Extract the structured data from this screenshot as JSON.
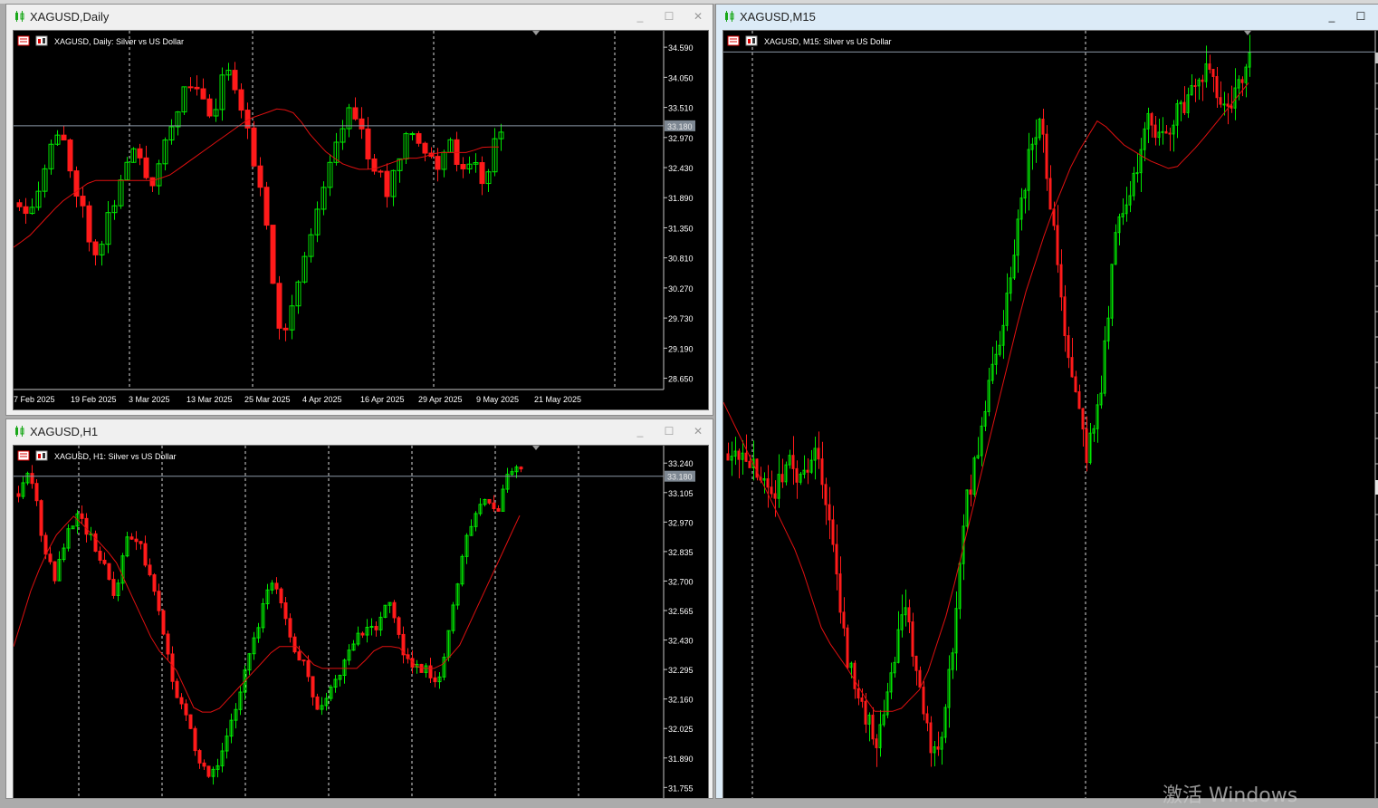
{
  "colors": {
    "bg": "#000000",
    "grid": "#d8d8d8",
    "axis": "#c8c8c8",
    "bull": "#00e600",
    "bear": "#ff1a1a",
    "ma": "#e01010",
    "bid": "#8b98a6",
    "text": "#ffffff",
    "tag_bg": "#7d8792"
  },
  "icons": {
    "window": "candlestick-icon",
    "chart_props": "chart-properties-icon",
    "chart_grid": "chart-grid-icon",
    "minimize": "minimize-icon",
    "maximize": "maximize-icon",
    "close": "close-icon",
    "shift": "chart-shift-marker-icon"
  },
  "windows": [
    {
      "title": "XAGUSD,Daily",
      "active": false,
      "buttons": {
        "minimize": "_",
        "maximize": "☐",
        "close": "✕"
      },
      "chart_data": {
        "type": "candlestick",
        "symbol_label": "XAGUSD, Daily:  Silver vs US Dollar",
        "y_ticks": [
          "34.590",
          "34.050",
          "33.510",
          "32.970",
          "32.430",
          "31.890",
          "31.350",
          "30.810",
          "30.270",
          "29.730",
          "29.190",
          "28.650"
        ],
        "y_range": [
          28.48,
          34.69
        ],
        "x_ticks": [
          "7 Feb 2025",
          "19 Feb 2025",
          "3 Mar 2025",
          "13 Mar 2025",
          "25 Mar 2025",
          "4 Apr 2025",
          "16 Apr 2025",
          "29 Apr 2025",
          "9 May 2025",
          "21 May 2025"
        ],
        "bid": 33.18,
        "bid_label": "33.180",
        "indicator": "moving average (red)",
        "grid": true,
        "close_path": [
          31.8,
          31.7,
          32.0,
          32.5,
          33.0,
          32.9,
          32.3,
          31.8,
          31.2,
          30.9,
          31.5,
          31.9,
          32.4,
          32.7,
          32.5,
          32.1,
          32.6,
          33.1,
          33.5,
          33.8,
          34.0,
          33.6,
          33.2,
          33.9,
          34.3,
          33.7,
          33.2,
          32.2,
          31.8,
          30.4,
          29.3,
          29.9,
          30.5,
          31.1,
          31.7,
          32.3,
          32.7,
          33.3,
          33.6,
          33.1,
          32.6,
          32.3,
          32.0,
          32.5,
          33.0,
          33.2,
          32.8,
          32.6,
          32.4,
          32.9,
          32.6,
          32.3,
          32.5,
          32.2,
          32.7,
          33.2
        ],
        "ma_path": [
          31.0,
          31.2,
          31.5,
          31.8,
          32.0,
          32.2,
          32.2,
          32.2,
          32.2,
          32.2,
          32.3,
          32.5,
          32.7,
          32.9,
          33.1,
          33.3,
          33.4,
          33.5,
          33.4,
          33.0,
          32.7,
          32.5,
          32.4,
          32.4,
          32.5,
          32.6,
          32.6,
          32.7,
          32.7,
          32.7,
          32.8,
          32.8
        ]
      }
    },
    {
      "title": "XAGUSD,H1",
      "active": false,
      "buttons": {
        "minimize": "_",
        "maximize": "☐",
        "close": "✕"
      },
      "chart_data": {
        "type": "candlestick",
        "symbol_label": "XAGUSD, H1:  Silver vs US Dollar",
        "y_ticks": [
          "33.240",
          "33.105",
          "32.970",
          "32.835",
          "32.700",
          "32.565",
          "32.430",
          "32.295",
          "32.160",
          "32.025",
          "31.890",
          "31.755"
        ],
        "y_range": [
          31.69,
          33.27
        ],
        "x_ticks": [],
        "bid": 33.18,
        "bid_label": "33.180",
        "indicator": "moving average (red)",
        "grid": true,
        "close_path": [
          33.1,
          33.2,
          32.9,
          32.7,
          32.9,
          33.0,
          32.9,
          32.8,
          32.6,
          32.9,
          32.9,
          32.7,
          32.5,
          32.2,
          32.1,
          31.9,
          31.8,
          31.9,
          32.1,
          32.3,
          32.5,
          32.7,
          32.6,
          32.4,
          32.3,
          32.1,
          32.2,
          32.3,
          32.4,
          32.5,
          32.5,
          32.6,
          32.4,
          32.3,
          32.3,
          32.2,
          32.5,
          32.8,
          33.0,
          33.1,
          33.0,
          33.2,
          33.2
        ],
        "ma_path": [
          32.4,
          32.7,
          32.9,
          33.0,
          32.9,
          32.8,
          32.6,
          32.4,
          32.3,
          32.1,
          32.1,
          32.2,
          32.3,
          32.4,
          32.4,
          32.3,
          32.3,
          32.3,
          32.4,
          32.4,
          32.3,
          32.3,
          32.4,
          32.6,
          32.8,
          33.0
        ]
      }
    },
    {
      "title": "XAGUSD,M15",
      "active": true,
      "buttons": {
        "minimize": "_",
        "maximize": "☐"
      },
      "chart_data": {
        "type": "candlestick",
        "symbol_label": "XAGUSD, M15:  Silver vs US Dollar",
        "y_ticks": [],
        "y_range": [
          31.73,
          33.2
        ],
        "x_ticks": [],
        "bid": 33.18,
        "bid_label": "",
        "indicator": "moving average (red)",
        "grid": true,
        "close_path": [
          32.4,
          32.4,
          32.35,
          32.3,
          32.4,
          32.35,
          32.4,
          32.25,
          32.0,
          31.9,
          31.85,
          32.0,
          32.1,
          31.9,
          31.8,
          32.0,
          32.3,
          32.45,
          32.6,
          32.75,
          32.95,
          33.05,
          32.8,
          32.55,
          32.4,
          32.5,
          32.85,
          32.9,
          33.05,
          33.0,
          33.05,
          33.1,
          33.15,
          33.08,
          33.1,
          33.18
        ],
        "ma_path": [
          32.5,
          32.4,
          32.3,
          32.2,
          32.05,
          31.98,
          31.9,
          31.9,
          31.95,
          32.1,
          32.3,
          32.5,
          32.7,
          32.85,
          32.97,
          33.05,
          33.0,
          32.97,
          32.95,
          33.0,
          33.06,
          33.12
        ]
      }
    }
  ],
  "watermark": "激活 Windows"
}
